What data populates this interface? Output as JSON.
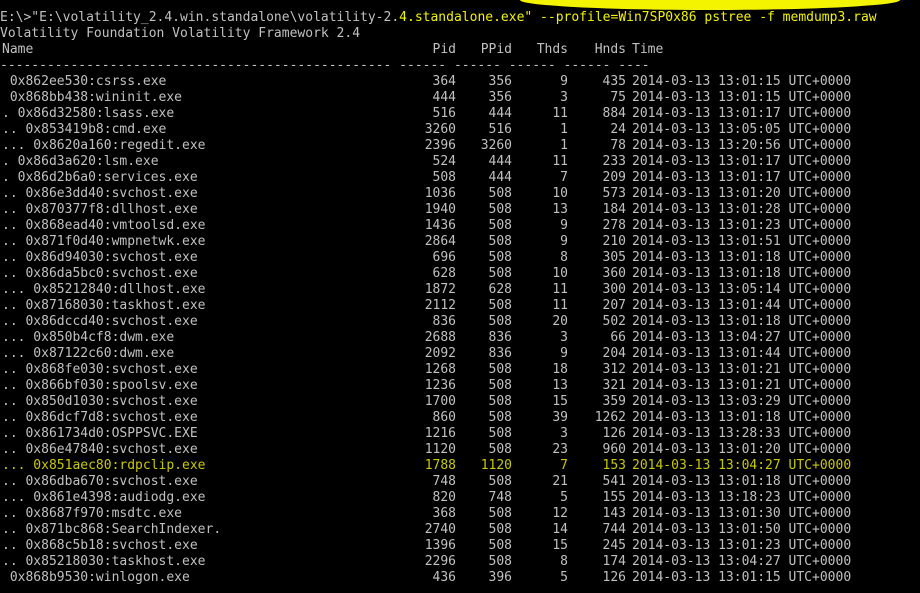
{
  "console": {
    "command_prefix": "E:\\>\"E:\\volatility_2.4.win.standalone\\volatility-2.",
    "command_highlight": "4.standalone.exe\" --profile=Win7SP0x86 pstree -f memdump3.raw",
    "banner": "Volatility Foundation Volatility Framework 2.4",
    "columns": {
      "name": "Name",
      "pid": "Pid",
      "ppid": "PPid",
      "thds": "Thds",
      "hnds": "Hnds",
      "time": "Time"
    },
    "separator": "-------------------------------------------------- ------ ------ ------ ------ ----",
    "highlight_color": "#f4f400",
    "text_color": "#c0c0c0",
    "background": "#000000"
  },
  "rows": [
    {
      "name": " 0x862ee530:csrss.exe",
      "pid": "364",
      "ppid": "356",
      "thds": "9",
      "hnds": "435",
      "time": "2014-03-13 13:01:15 UTC+0000"
    },
    {
      "name": " 0x868bb438:wininit.exe",
      "pid": "444",
      "ppid": "356",
      "thds": "3",
      "hnds": "75",
      "time": "2014-03-13 13:01:15 UTC+0000"
    },
    {
      "name": ". 0x86d32580:lsass.exe",
      "pid": "516",
      "ppid": "444",
      "thds": "11",
      "hnds": "884",
      "time": "2014-03-13 13:01:17 UTC+0000"
    },
    {
      "name": ".. 0x853419b8:cmd.exe",
      "pid": "3260",
      "ppid": "516",
      "thds": "1",
      "hnds": "24",
      "time": "2014-03-13 13:05:05 UTC+0000"
    },
    {
      "name": "... 0x8620a160:regedit.exe",
      "pid": "2396",
      "ppid": "3260",
      "thds": "1",
      "hnds": "78",
      "time": "2014-03-13 13:20:56 UTC+0000"
    },
    {
      "name": ". 0x86d3a620:lsm.exe",
      "pid": "524",
      "ppid": "444",
      "thds": "11",
      "hnds": "233",
      "time": "2014-03-13 13:01:17 UTC+0000"
    },
    {
      "name": ". 0x86d2b6a0:services.exe",
      "pid": "508",
      "ppid": "444",
      "thds": "7",
      "hnds": "209",
      "time": "2014-03-13 13:01:17 UTC+0000"
    },
    {
      "name": ".. 0x86e3dd40:svchost.exe",
      "pid": "1036",
      "ppid": "508",
      "thds": "10",
      "hnds": "573",
      "time": "2014-03-13 13:01:20 UTC+0000"
    },
    {
      "name": ".. 0x870377f8:dllhost.exe",
      "pid": "1940",
      "ppid": "508",
      "thds": "13",
      "hnds": "184",
      "time": "2014-03-13 13:01:28 UTC+0000"
    },
    {
      "name": ".. 0x868ead40:vmtoolsd.exe",
      "pid": "1436",
      "ppid": "508",
      "thds": "9",
      "hnds": "278",
      "time": "2014-03-13 13:01:23 UTC+0000"
    },
    {
      "name": ".. 0x871f0d40:wmpnetwk.exe",
      "pid": "2864",
      "ppid": "508",
      "thds": "9",
      "hnds": "210",
      "time": "2014-03-13 13:01:51 UTC+0000"
    },
    {
      "name": ".. 0x86d94030:svchost.exe",
      "pid": "696",
      "ppid": "508",
      "thds": "8",
      "hnds": "305",
      "time": "2014-03-13 13:01:18 UTC+0000"
    },
    {
      "name": ".. 0x86da5bc0:svchost.exe",
      "pid": "628",
      "ppid": "508",
      "thds": "10",
      "hnds": "360",
      "time": "2014-03-13 13:01:18 UTC+0000"
    },
    {
      "name": "... 0x85212840:dllhost.exe",
      "pid": "1872",
      "ppid": "628",
      "thds": "11",
      "hnds": "300",
      "time": "2014-03-13 13:05:14 UTC+0000"
    },
    {
      "name": ".. 0x87168030:taskhost.exe",
      "pid": "2112",
      "ppid": "508",
      "thds": "11",
      "hnds": "207",
      "time": "2014-03-13 13:01:44 UTC+0000"
    },
    {
      "name": ".. 0x86dccd40:svchost.exe",
      "pid": "836",
      "ppid": "508",
      "thds": "20",
      "hnds": "502",
      "time": "2014-03-13 13:01:18 UTC+0000"
    },
    {
      "name": "... 0x850b4cf8:dwm.exe",
      "pid": "2688",
      "ppid": "836",
      "thds": "3",
      "hnds": "66",
      "time": "2014-03-13 13:04:27 UTC+0000"
    },
    {
      "name": "... 0x87122c60:dwm.exe",
      "pid": "2092",
      "ppid": "836",
      "thds": "9",
      "hnds": "204",
      "time": "2014-03-13 13:01:44 UTC+0000"
    },
    {
      "name": ".. 0x868fe030:svchost.exe",
      "pid": "1268",
      "ppid": "508",
      "thds": "18",
      "hnds": "312",
      "time": "2014-03-13 13:01:21 UTC+0000"
    },
    {
      "name": ".. 0x866bf030:spoolsv.exe",
      "pid": "1236",
      "ppid": "508",
      "thds": "13",
      "hnds": "321",
      "time": "2014-03-13 13:01:21 UTC+0000"
    },
    {
      "name": ".. 0x850d1030:svchost.exe",
      "pid": "1700",
      "ppid": "508",
      "thds": "15",
      "hnds": "359",
      "time": "2014-03-13 13:03:29 UTC+0000"
    },
    {
      "name": ".. 0x86dcf7d8:svchost.exe",
      "pid": "860",
      "ppid": "508",
      "thds": "39",
      "hnds": "1262",
      "time": "2014-03-13 13:01:18 UTC+0000"
    },
    {
      "name": ".. 0x861734d0:OSPPSVC.EXE",
      "pid": "1216",
      "ppid": "508",
      "thds": "3",
      "hnds": "126",
      "time": "2014-03-13 13:28:33 UTC+0000"
    },
    {
      "name": ".. 0x86e47840:svchost.exe",
      "pid": "1120",
      "ppid": "508",
      "thds": "23",
      "hnds": "960",
      "time": "2014-03-13 13:01:20 UTC+0000"
    },
    {
      "name": "... 0x851aec80:rdpclip.exe",
      "pid": "1788",
      "ppid": "1120",
      "thds": "7",
      "hnds": "153",
      "time": "2014-03-13 13:04:27 UTC+0000",
      "yellow": true
    },
    {
      "name": ".. 0x86dba670:svchost.exe",
      "pid": "748",
      "ppid": "508",
      "thds": "21",
      "hnds": "541",
      "time": "2014-03-13 13:01:18 UTC+0000"
    },
    {
      "name": "... 0x861e4398:audiodg.exe",
      "pid": "820",
      "ppid": "748",
      "thds": "5",
      "hnds": "155",
      "time": "2014-03-13 13:18:23 UTC+0000"
    },
    {
      "name": ".. 0x8687f970:msdtc.exe",
      "pid": "368",
      "ppid": "508",
      "thds": "12",
      "hnds": "143",
      "time": "2014-03-13 13:01:30 UTC+0000"
    },
    {
      "name": ".. 0x871bc868:SearchIndexer.",
      "pid": "2740",
      "ppid": "508",
      "thds": "14",
      "hnds": "744",
      "time": "2014-03-13 13:01:50 UTC+0000"
    },
    {
      "name": ".. 0x868c5b18:svchost.exe",
      "pid": "1396",
      "ppid": "508",
      "thds": "15",
      "hnds": "245",
      "time": "2014-03-13 13:01:23 UTC+0000"
    },
    {
      "name": ".. 0x85218030:taskhost.exe",
      "pid": "2296",
      "ppid": "508",
      "thds": "8",
      "hnds": "174",
      "time": "2014-03-13 13:04:27 UTC+0000"
    },
    {
      "name": " 0x868b9530:winlogon.exe",
      "pid": "436",
      "ppid": "396",
      "thds": "5",
      "hnds": "126",
      "time": "2014-03-13 13:01:15 UTC+0000"
    }
  ]
}
